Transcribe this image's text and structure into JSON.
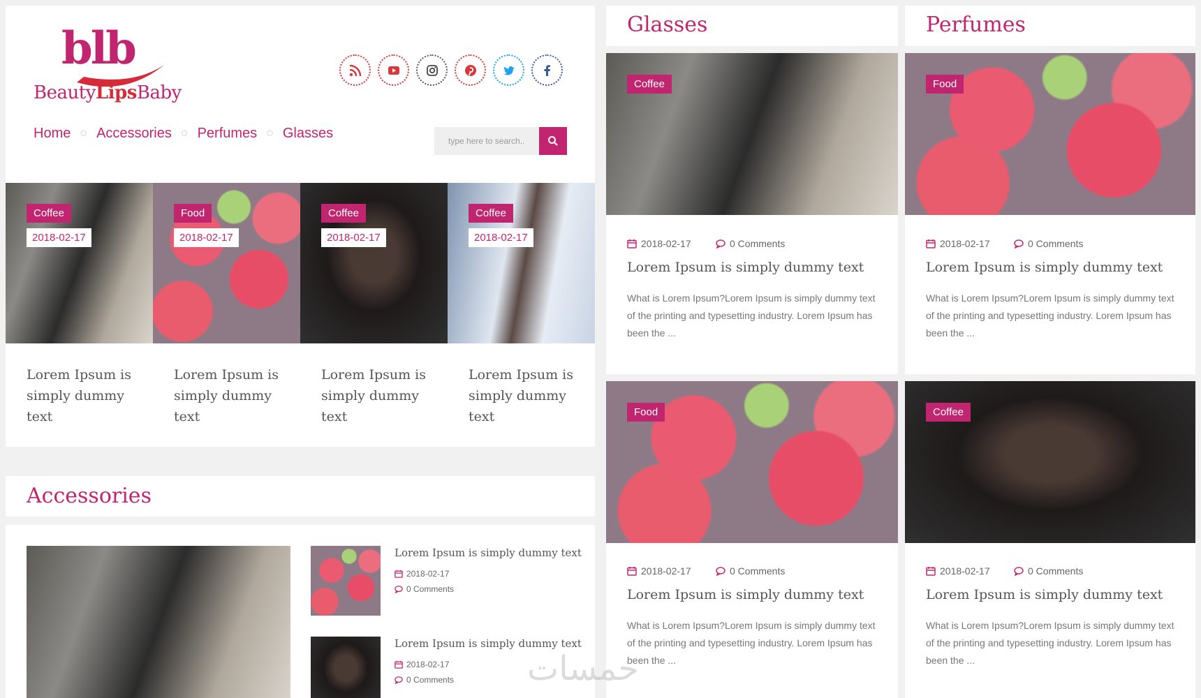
{
  "brand": {
    "logo_mark": "blb",
    "name_part1": "Beauty",
    "name_part2": "Lips",
    "name_part3": "Baby"
  },
  "social": [
    "rss-icon",
    "youtube-icon",
    "instagram-icon",
    "pinterest-icon",
    "twitter-icon",
    "facebook-icon"
  ],
  "nav": {
    "items": [
      "Home",
      "Accessories",
      "Perfumes",
      "Glasses"
    ]
  },
  "search": {
    "placeholder": "type here to search.."
  },
  "slider": [
    {
      "tag": "Coffee",
      "date": "2018-02-17",
      "title": "Lorem Ipsum is simply dummy text"
    },
    {
      "tag": "Food",
      "date": "2018-02-17",
      "title": "Lorem Ipsum is simply dummy text"
    },
    {
      "tag": "Coffee",
      "date": "2018-02-17",
      "title": "Lorem Ipsum is simply dummy text"
    },
    {
      "tag": "Coffee",
      "date": "2018-02-17",
      "title": "Lorem Ipsum is simply dummy text"
    }
  ],
  "accessories": {
    "title": "Accessories",
    "items": [
      {
        "title": "Lorem Ipsum is simply dummy text",
        "date": "2018-02-17",
        "comments": "0 Comments"
      },
      {
        "title": "Lorem Ipsum is simply dummy text",
        "date": "2018-02-17",
        "comments": "0 Comments"
      }
    ]
  },
  "glasses": {
    "title": "Glasses"
  },
  "perfumes": {
    "title": "Perfumes"
  },
  "cards": [
    {
      "tag": "Coffee",
      "date": "2018-02-17",
      "comments": "0 Comments",
      "title": "Lorem Ipsum is simply dummy text",
      "excerpt": "What is Lorem Ipsum?Lorem Ipsum is simply dummy text of the printing and typesetting industry. Lorem Ipsum has been the ..."
    },
    {
      "tag": "Food",
      "date": "2018-02-17",
      "comments": "0 Comments",
      "title": "Lorem Ipsum is simply dummy text",
      "excerpt": "What is Lorem Ipsum?Lorem Ipsum is simply dummy text of the printing and typesetting industry. Lorem Ipsum has been the ..."
    },
    {
      "tag": "Food",
      "date": "2018-02-17",
      "comments": "0 Comments",
      "title": "Lorem Ipsum is simply dummy text",
      "excerpt": "What is Lorem Ipsum?Lorem Ipsum is simply dummy text of the printing and typesetting industry. Lorem Ipsum has been the ..."
    },
    {
      "tag": "Coffee",
      "date": "2018-02-17",
      "comments": "0 Comments",
      "title": "Lorem Ipsum is simply dummy text",
      "excerpt": "What is Lorem Ipsum?Lorem Ipsum is simply dummy text of the printing and typesetting industry. Lorem Ipsum has been the ..."
    }
  ],
  "watermark": "خمسات",
  "colors": {
    "accent": "#c2256f",
    "social_ring": "#d9383a",
    "twitter": "#1da1f2",
    "facebook": "#3b5998"
  }
}
